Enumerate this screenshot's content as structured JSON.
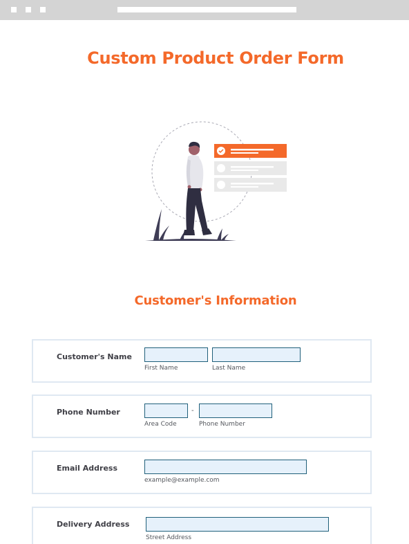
{
  "page": {
    "title": "Custom Product Order Form",
    "section_title": "Customer's Information"
  },
  "form": {
    "name": {
      "label": "Customer's Name",
      "first_sub": "First Name",
      "last_sub": "Last Name",
      "first_value": "",
      "last_value": ""
    },
    "phone": {
      "label": "Phone Number",
      "separator": "-",
      "area_sub": "Area Code",
      "number_sub": "Phone Number",
      "area_value": "",
      "number_value": ""
    },
    "email": {
      "label": "Email Address",
      "sub": "example@example.com",
      "value": ""
    },
    "delivery": {
      "label": "Delivery Address",
      "street_sub": "Street Address",
      "street_value": ""
    }
  },
  "colors": {
    "accent": "#f4692a",
    "input_fill": "#e6f1fb",
    "input_border": "#1f5f7a",
    "card_border": "#dfe8f2"
  }
}
